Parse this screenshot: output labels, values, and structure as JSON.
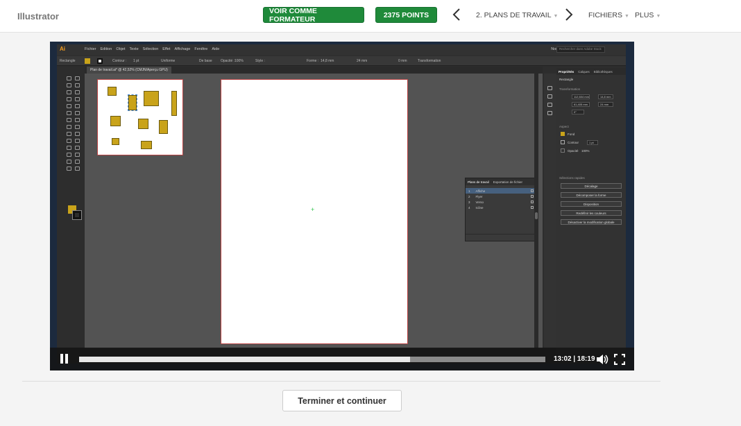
{
  "header": {
    "brand": "Illustrator",
    "trainer_button": "VOIR COMME FORMATEUR",
    "points_button": "2375 POINTS",
    "prev_icon": "chevron-left-icon",
    "next_icon": "chevron-right-icon",
    "lesson_title": "2. PLANS DE TRAVAIL",
    "files_label": "FICHIERS",
    "more_label": "PLUS",
    "accent_color": "#1f8a3a"
  },
  "illustrator": {
    "logo": "Ai",
    "menus": [
      "Fichier",
      "Edition",
      "Objet",
      "Texte",
      "Sélection",
      "Effet",
      "Affichage",
      "Fenêtre",
      "Aide"
    ],
    "workspace": "Normal",
    "search_placeholder": "Rechercher dans Adobe Stock",
    "control": {
      "object": "Rectangle",
      "stroke_label": "Contour :",
      "stroke_value": "1 pt",
      "stroke_profile": "Uniforme",
      "brush": "De base",
      "opacity_label": "Opacité :",
      "opacity_value": "100%",
      "style_label": "Style :",
      "width_label": "Forme :",
      "width_value": "14,8 mm",
      "height_value": "24 mm",
      "corner_value": "0 mm",
      "transform_label": "Transformation"
    },
    "document_tab": "Plan de travail.ai* @ 42,52% (CMJN/Aperçu GPU)",
    "fill_color": "#c9a31a",
    "artboards_panel": {
      "tabs": [
        "Plans de travail",
        "Exportation de fichier"
      ],
      "rows": [
        {
          "num": "1",
          "name": "Affiche"
        },
        {
          "num": "2",
          "name": "Flyer"
        },
        {
          "num": "3",
          "name": "Verso"
        },
        {
          "num": "4",
          "name": "Icône"
        }
      ]
    },
    "properties_panel": {
      "tabs": [
        "Propriétés",
        "Calques",
        "Bibliothèques"
      ],
      "object": "Rectangle",
      "transform_title": "Transformation",
      "x": "112,604 mm",
      "y": "61,405 mm",
      "w": "14,8 mm",
      "h": "24 mm",
      "angle": "0°",
      "appearance_title": "Aspect",
      "fill_label": "Fond",
      "stroke_label": "Contour",
      "stroke_value": "1 pt",
      "opacity_label": "Opacité",
      "opacity_value": "100%",
      "quick_title": "Sélections rapides",
      "quick_buttons": [
        "Décalage",
        "Décomposer la forme",
        "Disposition",
        "Redéfinir les couleurs",
        "Désactiver la modification globale"
      ]
    }
  },
  "player": {
    "timecode": "13:02 | 18:19",
    "progress": 0.71,
    "pause_icon": "pause-icon",
    "volume_icon": "volume-icon",
    "fullscreen_icon": "fullscreen-icon"
  },
  "footer": {
    "finish_button": "Terminer et continuer"
  }
}
